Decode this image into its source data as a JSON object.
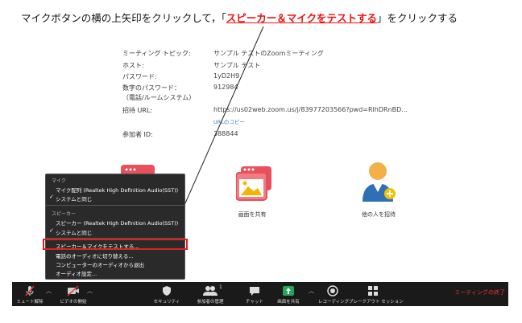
{
  "instruction": {
    "before": "マイクボタンの横の上矢印をクリックして，「",
    "highlight": "スピーカー＆マイクをテストする",
    "after": "」をクリックする"
  },
  "meeting_info": {
    "topic_label": "ミーティング トピック:",
    "topic_value": "サンプル テストのZoomミーティング",
    "host_label": "ホスト:",
    "host_value": "サンプル テスト",
    "password_label": "パスワード:",
    "password_value": "1yD2H9",
    "numeric_password_label": "数字のパスワード：",
    "numeric_password_sub": "（電話/ルームシステム）",
    "numeric_password_value": "912984",
    "invite_url_label": "招待 URL:",
    "invite_url_value": "https://us02web.zoom.us/j/83977203566?pwd=RlhDRnBD...",
    "copy_url": "URLのコピー",
    "participant_id_label": "参加者 ID:",
    "participant_id_value": "388844"
  },
  "tiles": {
    "share_screen": "画面を共有",
    "invite": "他の人を招待"
  },
  "audio_menu": {
    "mic_section": "マイク",
    "mic_device": "マイク配列 (Realtek High Definition Audio(SST))",
    "mic_same_as_system": "システムと同じ",
    "speaker_section": "スピーカー",
    "speaker_device": "スピーカー (Realtek High Definition Audio(SST))",
    "speaker_same_as_system": "システムと同じ",
    "test_speaker_mic": "スピーカー＆マイクをテストする...",
    "switch_to_phone": "電話のオーディオに切り替える...",
    "leave_computer_audio": "コンピューターのオーディオから退出",
    "audio_settings": "オーディオ設定..."
  },
  "toolbar": {
    "mute": "ミュート解除",
    "video": "ビデオの開始",
    "security": "セキュリティ",
    "participants": "参加者の管理",
    "participants_count": "1",
    "chat": "チャット",
    "share": "画面を共有",
    "record": "レコーディング",
    "breakout": "ブレークアウト セッション",
    "end": "ミーティングの終了"
  },
  "colors": {
    "accent_red": "#e02020",
    "toolbar_bg": "#1a1a1a",
    "share_green": "#23a55a",
    "tile_red": "#e8505b",
    "link_blue": "#3d7cc9"
  }
}
